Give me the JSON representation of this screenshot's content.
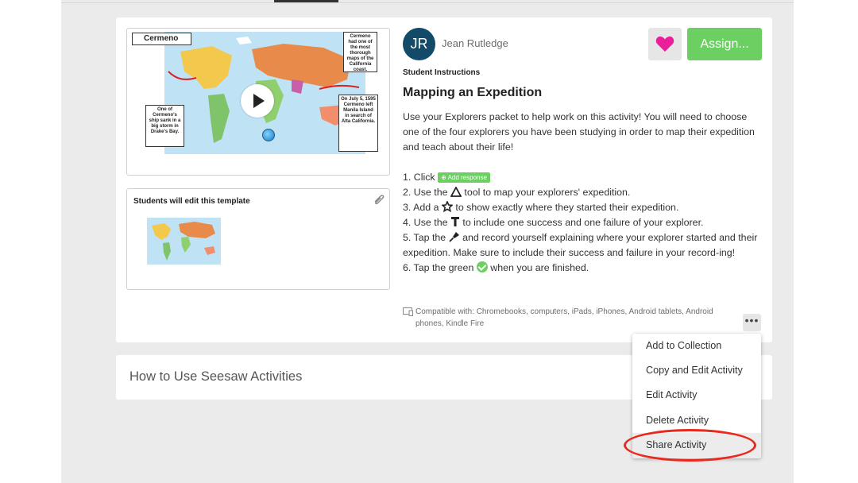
{
  "activity": {
    "video_title_tag": "Cermeno",
    "video_notes": [
      "Cermeno had one of the most thorough maps of the California coast.",
      "One of Cermeno's ship sank in a big storm in Drake's Bay.",
      "On July 5, 1595 Cermeno left Manila Island in search of Alta California."
    ],
    "template_label": "Students will edit this template",
    "author_initials": "JR",
    "author_name": "Jean Rutledge",
    "assign_label": "Assign...",
    "student_instructions_label": "Student Instructions",
    "title": "Mapping an Expedition",
    "intro": "Use your Explorers packet to help work on this activity! You will need to choose one of the four explorers you have been studying in order to map their expedition and teach about their life!",
    "steps": {
      "s1_pre": "1. Click",
      "add_response": "Add response",
      "s2_pre": "2. Use the",
      "s2_post": "tool to map your explorers' expedition.",
      "s3_pre": "3. Add a",
      "s3_post": "to show exactly where they started their expedition.",
      "s4_pre": "4. Use the",
      "s4_post": "to include one success and one failure of your explorer.",
      "s5_pre": "5. Tap the",
      "s5_post": "and record yourself explaining where your explorer started and their expedition. Make sure to include their success and failure in your record-ing!",
      "s6_pre": "6. Tap the green",
      "s6_post": "when you are finished."
    },
    "compatible": "Compatible with: Chromebooks, computers, iPads, iPhones, Android tablets, Android phones, Kindle Fire",
    "more_label": "•••",
    "colors": {
      "assign": "#6ccf62",
      "heart": "#ec1f9b",
      "avatar": "#124a67",
      "highlight": "#e8291c"
    }
  },
  "howto_label": "How to Use Seesaw Activities",
  "menu": {
    "items": [
      "Add to Collection",
      "Copy and Edit Activity",
      "Edit Activity",
      "Delete Activity",
      "Share Activity"
    ]
  }
}
